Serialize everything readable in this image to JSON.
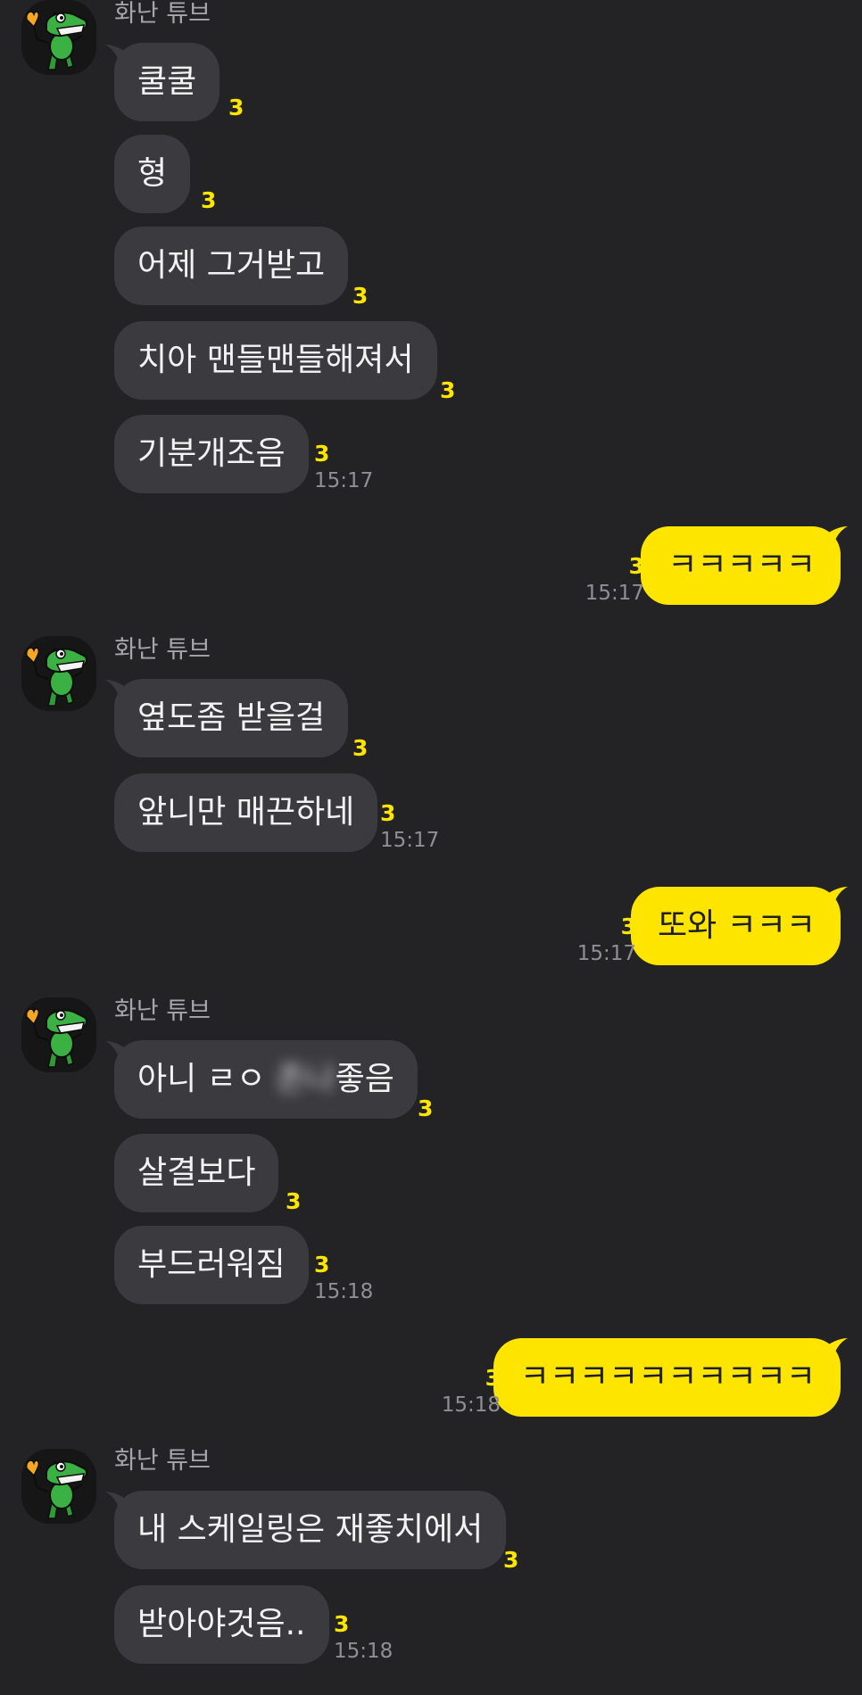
{
  "colors": {
    "background": "#232326",
    "incoming_bubble": "#3b3b3f",
    "outgoing_bubble": "#fee500",
    "unread_count": "#fee500"
  },
  "icons": {
    "avatar": "green-crocodile-character-icon"
  },
  "groups": [
    {
      "sender": "화난 튜브",
      "messages": [
        {
          "text": "쿨쿨",
          "unread": "3"
        },
        {
          "text": "형",
          "unread": "3"
        },
        {
          "text": "어제 그거받고",
          "unread": "3"
        },
        {
          "text": "치아 맨들맨들해져서",
          "unread": "3"
        },
        {
          "text": "기분개조음",
          "unread": "3",
          "time": "15:17"
        }
      ]
    },
    {
      "outgoing": {
        "text": "ㅋㅋㅋㅋㅋ",
        "unread": "3",
        "time": "15:17"
      }
    },
    {
      "sender": "화난 튜브",
      "messages": [
        {
          "text": "옆도좀 받을걸",
          "unread": "3"
        },
        {
          "text": "앞니만 매끈하네",
          "unread": "3",
          "time": "15:17"
        }
      ]
    },
    {
      "outgoing": {
        "text": "또와 ㅋㅋㅋ",
        "unread": "3",
        "time": "15:17"
      }
    },
    {
      "sender": "화난 튜브",
      "messages": [
        {
          "text_before": "아니 ㄹㅇ ",
          "text_blurred": "존나",
          "text_after": "좋음",
          "unread": "3"
        },
        {
          "text": "살결보다",
          "unread": "3"
        },
        {
          "text": "부드러워짐",
          "unread": "3",
          "time": "15:18"
        }
      ]
    },
    {
      "outgoing": {
        "text": "ㅋㅋㅋㅋㅋㅋㅋㅋㅋㅋ",
        "unread": "3",
        "time": "15:18"
      }
    },
    {
      "sender": "화난 튜브",
      "messages": [
        {
          "text": "내 스케일링은 재좋치에서",
          "unread": "3"
        },
        {
          "text": "받아야것음..",
          "unread": "3",
          "time": "15:18"
        }
      ]
    }
  ]
}
